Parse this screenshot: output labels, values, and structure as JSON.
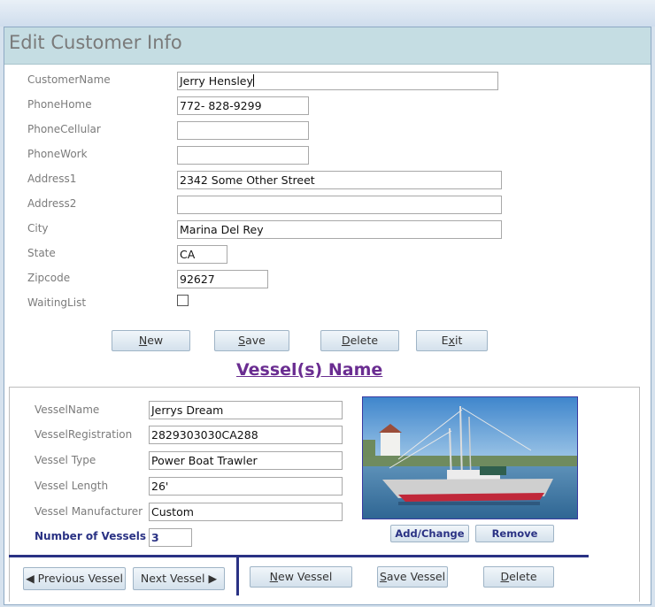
{
  "form": {
    "title": "Edit Customer Info"
  },
  "customer": {
    "name_label": "CustomerName",
    "name_value": "Jerry Hensley",
    "phone_home_label": "PhoneHome",
    "phone_home_value": "772- 828-9299",
    "phone_cell_label": "PhoneCellular",
    "phone_cell_value": "",
    "phone_work_label": "PhoneWork",
    "phone_work_value": "",
    "address1_label": "Address1",
    "address1_value": "2342 Some Other Street",
    "address2_label": "Address2",
    "address2_value": "",
    "city_label": "City",
    "city_value": "Marina Del Rey",
    "state_label": "State",
    "state_value": "CA",
    "zip_label": "Zipcode",
    "zip_value": "92627",
    "waiting_label": "WaitingList",
    "waiting_checked": false
  },
  "actions": {
    "new_prefix": "N",
    "new_rest": "ew",
    "save_prefix": "S",
    "save_rest": "ave",
    "delete_prefix": "D",
    "delete_rest": "elete",
    "exit_prefix": "E",
    "exit_mid": "x",
    "exit_rest": "it"
  },
  "vessel_section": {
    "heading": "Vessel(s) Name"
  },
  "vessel": {
    "name_label": "VesselName",
    "name_value": "Jerrys Dream",
    "reg_label": "VesselRegistration",
    "reg_value": "2829303030CA288",
    "type_label": "Vessel Type",
    "type_value": "Power Boat Trawler",
    "length_label": "Vessel Length",
    "length_value": "26'",
    "mfr_label": "Vessel Manufacturer",
    "mfr_value": "Custom",
    "count_label": "Number of Vessels",
    "count_value": "3",
    "add_change_label": "Add/Change",
    "remove_label": "Remove"
  },
  "vessel_nav": {
    "prev_label": "Previous Vessel",
    "next_label": "Next Vessel",
    "new_prefix": "N",
    "new_rest": "ew Vessel",
    "save_prefix": "S",
    "save_rest": "ave Vessel",
    "delete_prefix": "D",
    "delete_rest": "elete"
  },
  "colors": {
    "header": "#c5dde3",
    "accent": "#2a3284",
    "heading": "#6a2d91"
  }
}
